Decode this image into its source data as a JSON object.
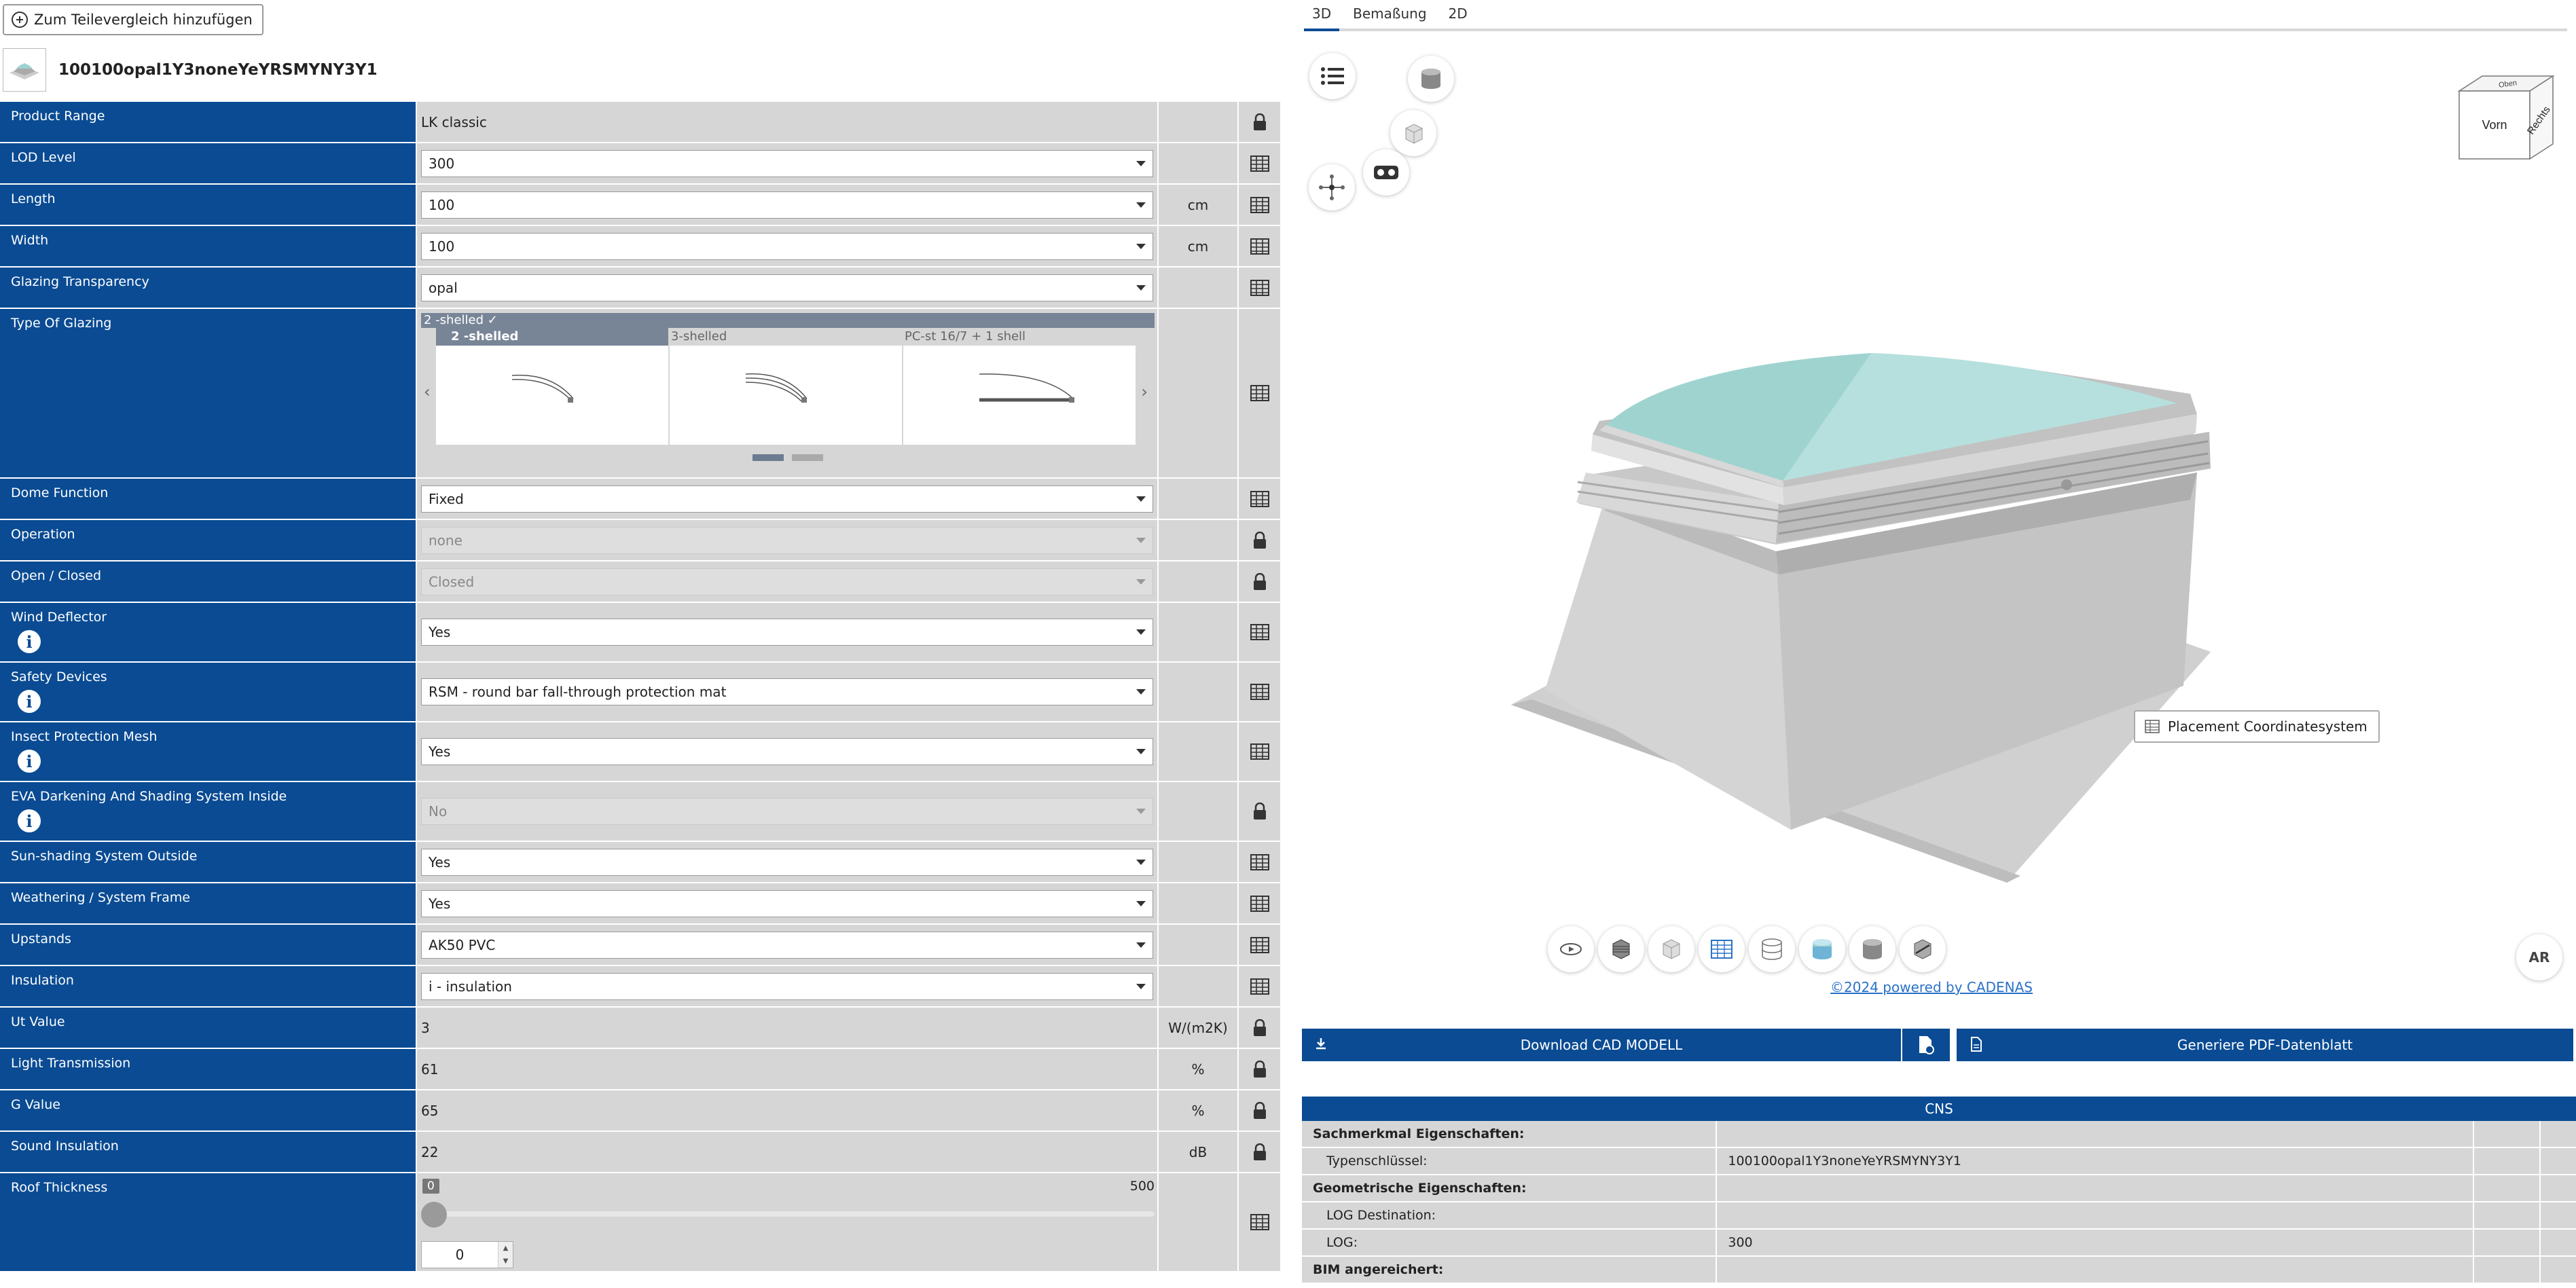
{
  "toolbar": {
    "compare_label": "Zum Teilevergleich hinzufügen"
  },
  "part": {
    "title": "100100opal1Y3noneYeYRSMYNY3Y1"
  },
  "rows": [
    {
      "label": "Product Range",
      "value": "LK classic"
    },
    {
      "label": "LOD Level",
      "value": "300"
    },
    {
      "label": "Length",
      "value": "100",
      "unit": "cm"
    },
    {
      "label": "Width",
      "value": "100",
      "unit": "cm"
    },
    {
      "label": "Glazing Transparency",
      "value": "opal"
    },
    {
      "label": "Type Of Glazing",
      "selected": "2 -shelled ✓",
      "options": [
        "2 -shelled",
        "3-shelled",
        "PC-st 16/7 + 1 shell"
      ]
    },
    {
      "label": "Dome Function",
      "value": "Fixed"
    },
    {
      "label": "Operation",
      "value": "none"
    },
    {
      "label": "Open / Closed",
      "value": "Closed"
    },
    {
      "label": "Wind Deflector",
      "value": "Yes"
    },
    {
      "label": "Safety Devices",
      "value": "RSM - round bar fall-through protection mat"
    },
    {
      "label": "Insect Protection Mesh",
      "value": "Yes"
    },
    {
      "label": "EVA Darkening And Shading System Inside",
      "value": "No"
    },
    {
      "label": "Sun-shading System Outside",
      "value": "Yes"
    },
    {
      "label": "Weathering / System Frame",
      "value": "Yes"
    },
    {
      "label": "Upstands",
      "value": "AK50 PVC"
    },
    {
      "label": "Insulation",
      "value": "i - insulation"
    },
    {
      "label": "Ut Value",
      "value": "3",
      "unit": "W/(m2K)"
    },
    {
      "label": "Light Transmission",
      "value": "61",
      "unit": "%"
    },
    {
      "label": "G Value",
      "value": "65",
      "unit": "%"
    },
    {
      "label": "Sound Insulation",
      "value": "22",
      "unit": "dB"
    },
    {
      "label": "Roof Thickness",
      "min": "0",
      "max": "500",
      "value": "0",
      "level": 0
    }
  ],
  "tabs": [
    "3D",
    "Bemaßung",
    "2D"
  ],
  "viewcube": {
    "front": "Vorn",
    "right": "Rechts",
    "top": "Oben"
  },
  "viewer": {
    "tooltip": "Placement Coordinatesystem",
    "ar": "AR",
    "powered": "©2024 powered by CADENAS"
  },
  "actions": {
    "download": "Download CAD MODELL",
    "pdf": "Generiere PDF-Datenblatt"
  },
  "cns": {
    "title": "CNS",
    "rows": [
      {
        "k": "Sachmerkmal Eigenschaften:",
        "v": "",
        "type": "sec"
      },
      {
        "k": "Typenschlüssel:",
        "v": "100100opal1Y3noneYeYRSMYNY3Y1",
        "type": "sub"
      },
      {
        "k": "Geometrische Eigenschaften:",
        "v": "",
        "type": "sec"
      },
      {
        "k": "LOG Destination:",
        "v": "",
        "type": "sub"
      },
      {
        "k": "LOG:",
        "v": "300",
        "type": "sub"
      },
      {
        "k": "BIM angereichert:",
        "v": "",
        "type": "sec"
      }
    ]
  },
  "colors": {
    "accent": "#0a4b93",
    "glass": "#9fd3d0"
  }
}
